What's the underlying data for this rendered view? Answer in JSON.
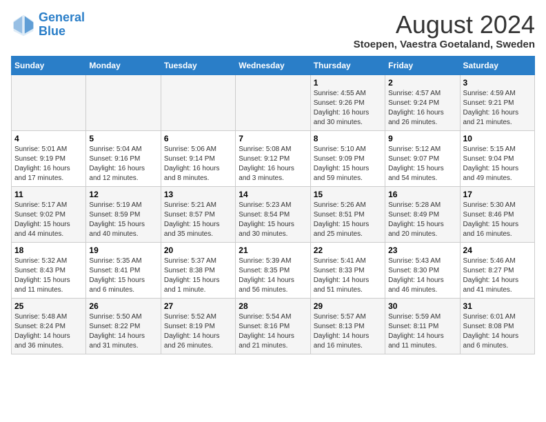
{
  "logo": {
    "text_general": "General",
    "text_blue": "Blue"
  },
  "title": "August 2024",
  "subtitle": "Stoepen, Vaestra Goetaland, Sweden",
  "days_header": [
    "Sunday",
    "Monday",
    "Tuesday",
    "Wednesday",
    "Thursday",
    "Friday",
    "Saturday"
  ],
  "weeks": [
    [
      {
        "day": "",
        "info": ""
      },
      {
        "day": "",
        "info": ""
      },
      {
        "day": "",
        "info": ""
      },
      {
        "day": "",
        "info": ""
      },
      {
        "day": "1",
        "info": "Sunrise: 4:55 AM\nSunset: 9:26 PM\nDaylight: 16 hours\nand 30 minutes."
      },
      {
        "day": "2",
        "info": "Sunrise: 4:57 AM\nSunset: 9:24 PM\nDaylight: 16 hours\nand 26 minutes."
      },
      {
        "day": "3",
        "info": "Sunrise: 4:59 AM\nSunset: 9:21 PM\nDaylight: 16 hours\nand 21 minutes."
      }
    ],
    [
      {
        "day": "4",
        "info": "Sunrise: 5:01 AM\nSunset: 9:19 PM\nDaylight: 16 hours\nand 17 minutes."
      },
      {
        "day": "5",
        "info": "Sunrise: 5:04 AM\nSunset: 9:16 PM\nDaylight: 16 hours\nand 12 minutes."
      },
      {
        "day": "6",
        "info": "Sunrise: 5:06 AM\nSunset: 9:14 PM\nDaylight: 16 hours\nand 8 minutes."
      },
      {
        "day": "7",
        "info": "Sunrise: 5:08 AM\nSunset: 9:12 PM\nDaylight: 16 hours\nand 3 minutes."
      },
      {
        "day": "8",
        "info": "Sunrise: 5:10 AM\nSunset: 9:09 PM\nDaylight: 15 hours\nand 59 minutes."
      },
      {
        "day": "9",
        "info": "Sunrise: 5:12 AM\nSunset: 9:07 PM\nDaylight: 15 hours\nand 54 minutes."
      },
      {
        "day": "10",
        "info": "Sunrise: 5:15 AM\nSunset: 9:04 PM\nDaylight: 15 hours\nand 49 minutes."
      }
    ],
    [
      {
        "day": "11",
        "info": "Sunrise: 5:17 AM\nSunset: 9:02 PM\nDaylight: 15 hours\nand 44 minutes."
      },
      {
        "day": "12",
        "info": "Sunrise: 5:19 AM\nSunset: 8:59 PM\nDaylight: 15 hours\nand 40 minutes."
      },
      {
        "day": "13",
        "info": "Sunrise: 5:21 AM\nSunset: 8:57 PM\nDaylight: 15 hours\nand 35 minutes."
      },
      {
        "day": "14",
        "info": "Sunrise: 5:23 AM\nSunset: 8:54 PM\nDaylight: 15 hours\nand 30 minutes."
      },
      {
        "day": "15",
        "info": "Sunrise: 5:26 AM\nSunset: 8:51 PM\nDaylight: 15 hours\nand 25 minutes."
      },
      {
        "day": "16",
        "info": "Sunrise: 5:28 AM\nSunset: 8:49 PM\nDaylight: 15 hours\nand 20 minutes."
      },
      {
        "day": "17",
        "info": "Sunrise: 5:30 AM\nSunset: 8:46 PM\nDaylight: 15 hours\nand 16 minutes."
      }
    ],
    [
      {
        "day": "18",
        "info": "Sunrise: 5:32 AM\nSunset: 8:43 PM\nDaylight: 15 hours\nand 11 minutes."
      },
      {
        "day": "19",
        "info": "Sunrise: 5:35 AM\nSunset: 8:41 PM\nDaylight: 15 hours\nand 6 minutes."
      },
      {
        "day": "20",
        "info": "Sunrise: 5:37 AM\nSunset: 8:38 PM\nDaylight: 15 hours\nand 1 minute."
      },
      {
        "day": "21",
        "info": "Sunrise: 5:39 AM\nSunset: 8:35 PM\nDaylight: 14 hours\nand 56 minutes."
      },
      {
        "day": "22",
        "info": "Sunrise: 5:41 AM\nSunset: 8:33 PM\nDaylight: 14 hours\nand 51 minutes."
      },
      {
        "day": "23",
        "info": "Sunrise: 5:43 AM\nSunset: 8:30 PM\nDaylight: 14 hours\nand 46 minutes."
      },
      {
        "day": "24",
        "info": "Sunrise: 5:46 AM\nSunset: 8:27 PM\nDaylight: 14 hours\nand 41 minutes."
      }
    ],
    [
      {
        "day": "25",
        "info": "Sunrise: 5:48 AM\nSunset: 8:24 PM\nDaylight: 14 hours\nand 36 minutes."
      },
      {
        "day": "26",
        "info": "Sunrise: 5:50 AM\nSunset: 8:22 PM\nDaylight: 14 hours\nand 31 minutes."
      },
      {
        "day": "27",
        "info": "Sunrise: 5:52 AM\nSunset: 8:19 PM\nDaylight: 14 hours\nand 26 minutes."
      },
      {
        "day": "28",
        "info": "Sunrise: 5:54 AM\nSunset: 8:16 PM\nDaylight: 14 hours\nand 21 minutes."
      },
      {
        "day": "29",
        "info": "Sunrise: 5:57 AM\nSunset: 8:13 PM\nDaylight: 14 hours\nand 16 minutes."
      },
      {
        "day": "30",
        "info": "Sunrise: 5:59 AM\nSunset: 8:11 PM\nDaylight: 14 hours\nand 11 minutes."
      },
      {
        "day": "31",
        "info": "Sunrise: 6:01 AM\nSunset: 8:08 PM\nDaylight: 14 hours\nand 6 minutes."
      }
    ]
  ]
}
